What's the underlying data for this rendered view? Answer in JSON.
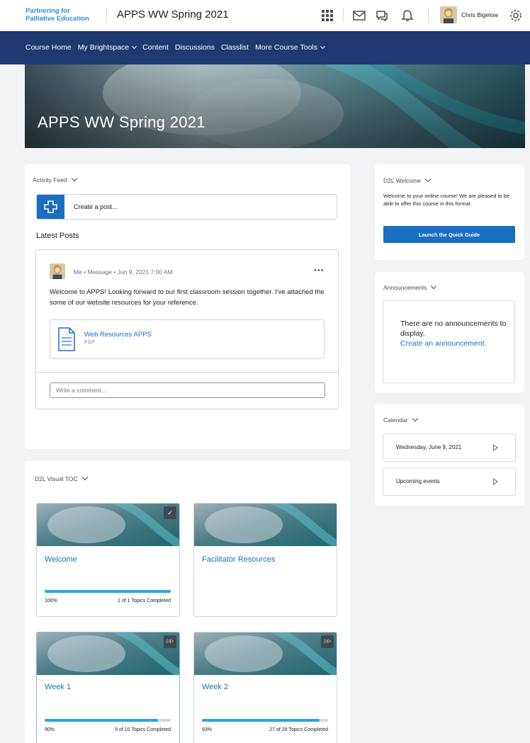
{
  "header": {
    "org_line1": "Partnering for",
    "org_line2": "Palliative Education",
    "course_title": "APPS WW Spring 2021",
    "user_name": "Chris Bigelow",
    "icons": [
      "waffle-icon",
      "mail-icon",
      "chat-icon",
      "bell-icon",
      "gear-icon"
    ]
  },
  "nav": {
    "items": [
      "Course Home",
      "My Brightspace",
      "Content",
      "Discussions",
      "Classlist",
      "More Course Tools"
    ]
  },
  "banner": {
    "title": "APPS WW Spring 2021"
  },
  "activity": {
    "heading": "Activity Feed",
    "create_placeholder": "Create a post...",
    "latest_label": "Latest Posts",
    "post": {
      "meta": "Me • Message • Jun 9, 2021 7:00 AM",
      "body": "Welcome to APPS! Looking forward to our first classroom session together. I've attached the some of our website resources for your reference.",
      "attachment_title": "Web Resources APPS",
      "attachment_type": "PDF",
      "comment_placeholder": "Write a comment..."
    }
  },
  "welcome_widget": {
    "heading": "D2L Welcome",
    "text": "Welcome to your online course! We are pleased to be able to offer this course in this format.",
    "button": "Launch the Quick Guide"
  },
  "announcements": {
    "heading": "Announcements",
    "empty_text": "There are no announcements to display.",
    "create_link": "Create an announcement."
  },
  "calendar": {
    "heading": "Calendar",
    "date_label": "Wednesday, June 9, 2021",
    "upcoming_label": "Upcoming events"
  },
  "toc": {
    "heading": "D2L Visual TOC",
    "tiles": [
      {
        "title": "Welcome",
        "percent": "100%",
        "progress": 1.0,
        "topics": "1 of 1 Topics Completed",
        "badge": "✓"
      },
      {
        "title": "Facilitator Resources",
        "percent": "",
        "progress": null,
        "topics": "",
        "badge": ""
      },
      {
        "title": "Week 1",
        "percent": "90%",
        "progress": 0.9,
        "topics": "9 of 10 Topics Completed",
        "badge": "▷▷"
      },
      {
        "title": "Week 2",
        "percent": "93%",
        "progress": 0.93,
        "topics": "27 of 29 Topics Completed",
        "badge": "▷▷"
      }
    ]
  },
  "colors": {
    "nav_bg": "#1f3a70",
    "accent_blue": "#1a6fc2",
    "progress": "#29a6e3",
    "page_bg": "#f1f3f5"
  }
}
